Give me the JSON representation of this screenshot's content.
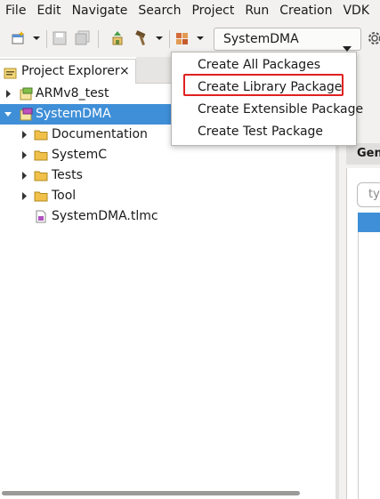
{
  "menu": [
    "File",
    "Edit",
    "Navigate",
    "Search",
    "Project",
    "Run",
    "Creation",
    "VDK"
  ],
  "toolbar": {
    "combo_value": "SystemDMA"
  },
  "explorer": {
    "tab_label": "Project Explorer",
    "close": "×",
    "tree": [
      {
        "label": "ARMv8_test",
        "expanded": false,
        "selected": false
      },
      {
        "label": "SystemDMA",
        "expanded": true,
        "selected": true
      },
      {
        "label": "Documentation",
        "expanded": false
      },
      {
        "label": "SystemC",
        "expanded": false
      },
      {
        "label": "Tests",
        "expanded": false
      },
      {
        "label": "Tool",
        "expanded": false
      },
      {
        "label": "SystemDMA.tlmc"
      }
    ]
  },
  "right_panel": {
    "section": "Gen",
    "field_placeholder": "ty"
  },
  "popup": {
    "items": [
      "Create All Packages",
      "Create Library Package",
      "Create Extensible Package",
      "Create Test Package"
    ],
    "highlighted": "Create Library Package"
  },
  "colors": {
    "selection": "#3f8fd8",
    "highlight_border": "#e02020",
    "menu_bg": "#f2f1f0"
  }
}
